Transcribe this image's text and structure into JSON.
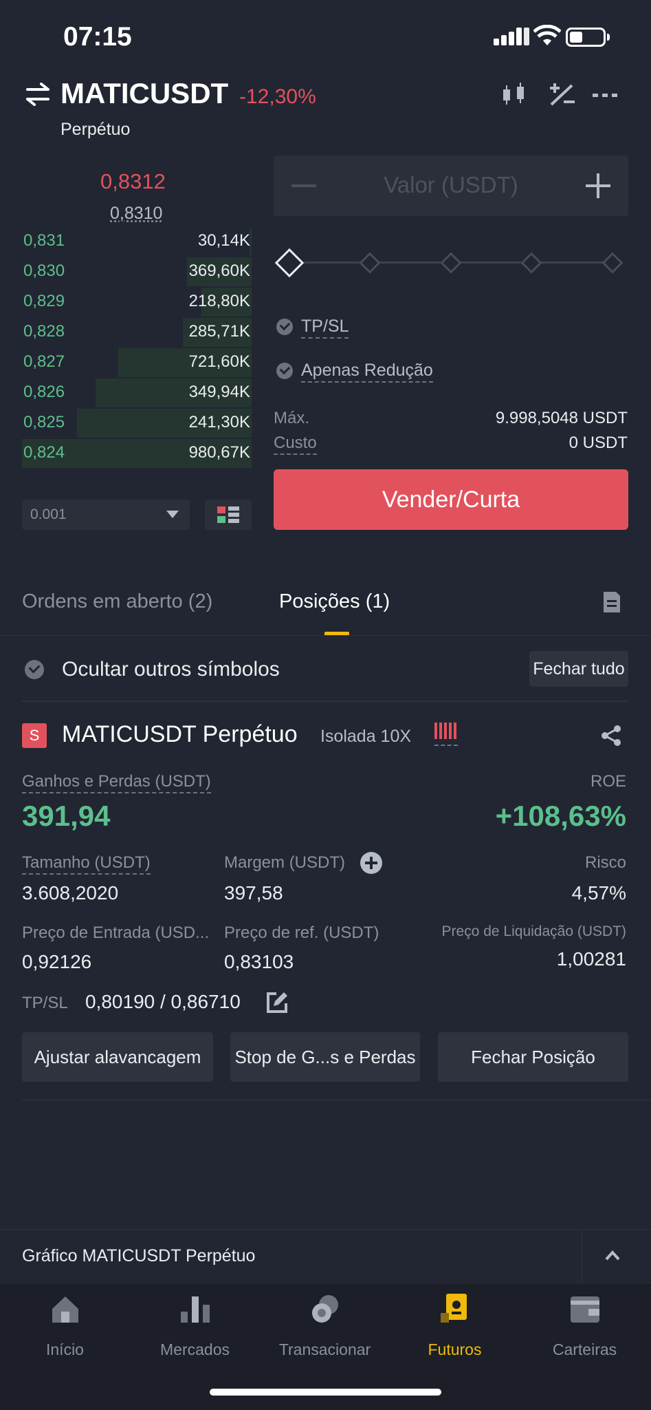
{
  "status": {
    "time": "07:15"
  },
  "header": {
    "pair": "MATICUSDT",
    "change": "-12,30%",
    "contract": "Perpétuo"
  },
  "orderbook": {
    "last_price": "0,8312",
    "mark_price": "0,8310",
    "bids": [
      {
        "price": "0,831",
        "qty": "30,14K",
        "depth": 0.01
      },
      {
        "price": "0,830",
        "qty": "369,60K",
        "depth": 0.28
      },
      {
        "price": "0,829",
        "qty": "218,80K",
        "depth": 0.22
      },
      {
        "price": "0,828",
        "qty": "285,71K",
        "depth": 0.3
      },
      {
        "price": "0,827",
        "qty": "721,60K",
        "depth": 0.58
      },
      {
        "price": "0,826",
        "qty": "349,94K",
        "depth": 0.68
      },
      {
        "price": "0,825",
        "qty": "241,30K",
        "depth": 0.76
      },
      {
        "price": "0,824",
        "qty": "980,67K",
        "depth": 1.0
      }
    ],
    "precision": "0.001"
  },
  "form": {
    "value_placeholder": "Valor (USDT)",
    "tpsl_label": "TP/SL",
    "reduce_only_label": "Apenas Redução",
    "max_label": "Máx.",
    "max_value": "9.998,5048 USDT",
    "cost_label": "Custo",
    "cost_value": "0 USDT",
    "sell_label": "Vender/Curta"
  },
  "tabs": {
    "open_orders": "Ordens em aberto (2)",
    "positions": "Posições (1)"
  },
  "positions": {
    "hide_others_label": "Ocultar outros símbolos",
    "close_all_label": "Fechar tudo",
    "item": {
      "side_badge": "S",
      "title": "MATICUSDT Perpétuo",
      "mode": "Isolada 10X",
      "pnl_label": "Ganhos e Perdas (USDT)",
      "pnl_value": "391,94",
      "roe_label": "ROE",
      "roe_value": "+108,63%",
      "size_label": "Tamanho (USDT)",
      "size_value": "3.608,2020",
      "margin_label": "Margem (USDT)",
      "margin_value": "397,58",
      "risk_label": "Risco",
      "risk_value": "4,57%",
      "entry_label": "Preço de Entrada (USD...",
      "entry_value": "0,92126",
      "ref_label": "Preço de ref. (USDT)",
      "ref_value": "0,83103",
      "liq_label": "Preço de Liquidação (USDT)",
      "liq_value": "1,00281",
      "tpsl_label": "TP/SL",
      "tpsl_value": "0,80190 / 0,86710",
      "btn_leverage": "Ajustar alavancagem",
      "btn_stop": "Stop de G...s e Perdas",
      "btn_close": "Fechar Posição"
    }
  },
  "chart_bar": {
    "label": "Gráfico MATICUSDT Perpétuo"
  },
  "nav": [
    {
      "label": "Início",
      "icon": "home-icon"
    },
    {
      "label": "Mercados",
      "icon": "markets-icon"
    },
    {
      "label": "Transacionar",
      "icon": "trade-icon"
    },
    {
      "label": "Futuros",
      "icon": "futures-icon"
    },
    {
      "label": "Carteiras",
      "icon": "wallet-icon"
    }
  ],
  "colors": {
    "background": "#222632",
    "green": "#5cbf8c",
    "red": "#e2525d",
    "accent": "#f0b90b"
  }
}
